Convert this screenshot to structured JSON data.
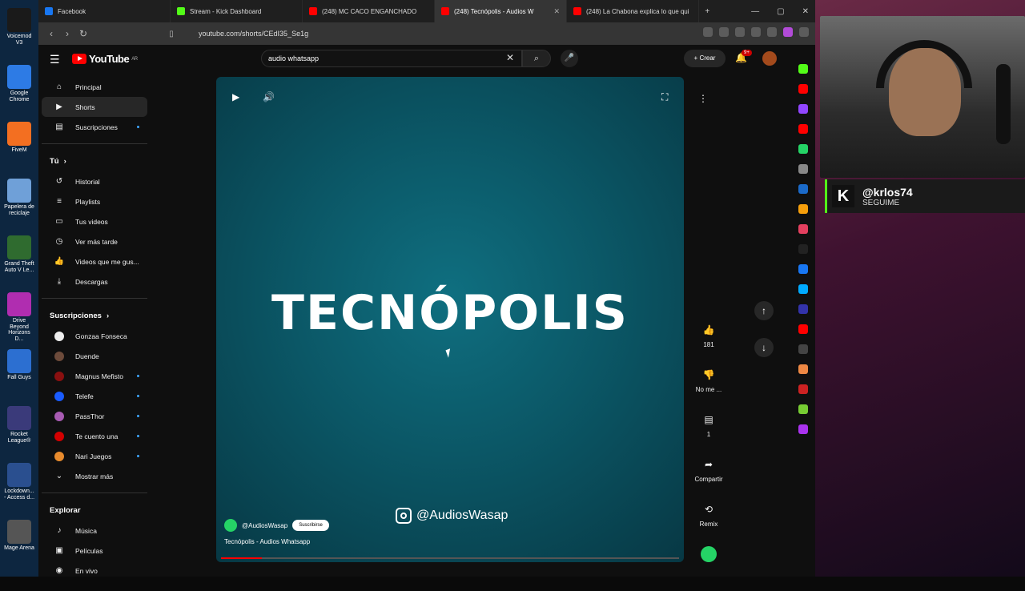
{
  "desktop_icons": [
    {
      "label": "Voicemod V3",
      "color": "#1a1a1a"
    },
    {
      "label": "Google Chrome",
      "color": "#2d7be5"
    },
    {
      "label": "FiveM",
      "color": "#f36f21"
    },
    {
      "label": "Papelera de reciclaje",
      "color": "#6fa0d8"
    },
    {
      "label": "Grand Theft Auto V Le...",
      "color": "#2f6b2f"
    },
    {
      "label": "Drive Beyond Horizons D...",
      "color": "#b02db0"
    },
    {
      "label": "Fall Guys",
      "color": "#2c6fd1"
    },
    {
      "label": "Rocket League®",
      "color": "#3a3a7a"
    },
    {
      "label": "Lockdown... - Access d...",
      "color": "#2a4f8f"
    },
    {
      "label": "Mage Arena",
      "color": "#555"
    }
  ],
  "tabs": [
    {
      "label": "Facebook",
      "color": "#1877f2",
      "active": false
    },
    {
      "label": "Stream - Kick Dashboard",
      "color": "#53fc18",
      "active": false
    },
    {
      "label": "(248) MC CACO ENGANCHADO",
      "color": "#f00",
      "active": false
    },
    {
      "label": "(248) Tecnópolis - Audios W",
      "color": "#f00",
      "active": true
    },
    {
      "label": "(248) La Chabona explica lo que qui",
      "color": "#f00",
      "active": false
    }
  ],
  "address": {
    "url": "youtube.com/shorts/CEdI35_Se1g"
  },
  "yt": {
    "logo": "YouTube",
    "region": "AR",
    "search_value": "audio whatsapp",
    "create_label": "Crear",
    "notif_count": "9+"
  },
  "sidebar": {
    "main": [
      {
        "label": "Principal",
        "icon": "home-icon",
        "glyph": "⌂"
      },
      {
        "label": "Shorts",
        "icon": "shorts-icon",
        "glyph": "▶",
        "active": true
      },
      {
        "label": "Suscripciones",
        "icon": "subscriptions-icon",
        "glyph": "▤",
        "dot": true
      }
    ],
    "you_header": "Tú",
    "you": [
      {
        "label": "Historial",
        "icon": "history-icon",
        "glyph": "↺"
      },
      {
        "label": "Playlists",
        "icon": "playlists-icon",
        "glyph": "≡"
      },
      {
        "label": "Tus videos",
        "icon": "your-videos-icon",
        "glyph": "▭"
      },
      {
        "label": "Ver más tarde",
        "icon": "watch-later-icon",
        "glyph": "◷"
      },
      {
        "label": "Videos que me gus...",
        "icon": "liked-icon",
        "glyph": "👍"
      },
      {
        "label": "Descargas",
        "icon": "downloads-icon",
        "glyph": "⤓"
      }
    ],
    "subs_header": "Suscripciones",
    "subs": [
      {
        "label": "Gonzaa Fonseca",
        "color": "#eee",
        "dot": false
      },
      {
        "label": "Duende",
        "color": "#6d4b3b",
        "dot": false
      },
      {
        "label": "Magnus Mefisto",
        "color": "#8a1010",
        "dot": true
      },
      {
        "label": "Telefe",
        "color": "#1a5cff",
        "dot": true
      },
      {
        "label": "PassThor",
        "color": "#a85bb3",
        "dot": true
      },
      {
        "label": "Te cuento una",
        "color": "#d40000",
        "dot": true
      },
      {
        "label": "Nari Juegos",
        "color": "#e88b2d",
        "dot": true
      }
    ],
    "more": "Mostrar más",
    "explore_header": "Explorar",
    "explore": [
      {
        "label": "Música",
        "icon": "music-icon",
        "glyph": "♪"
      },
      {
        "label": "Películas",
        "icon": "movies-icon",
        "glyph": "▣"
      },
      {
        "label": "En vivo",
        "icon": "live-icon",
        "glyph": "◉"
      }
    ]
  },
  "short": {
    "big_title": "TECNÓPOLIS",
    "instagram": "@AudiosWasap",
    "channel": "@AudiosWasap",
    "subscribe": "Suscribirse",
    "title": "Tecnópolis - Audios Whatsapp",
    "progress": 0.09
  },
  "actions": {
    "likes": "181",
    "dislike": "No me ...",
    "comments": "1",
    "share": "Compartir",
    "remix": "Remix"
  },
  "stream": {
    "handle": "@krlos74",
    "cta": "SEGUIME"
  }
}
